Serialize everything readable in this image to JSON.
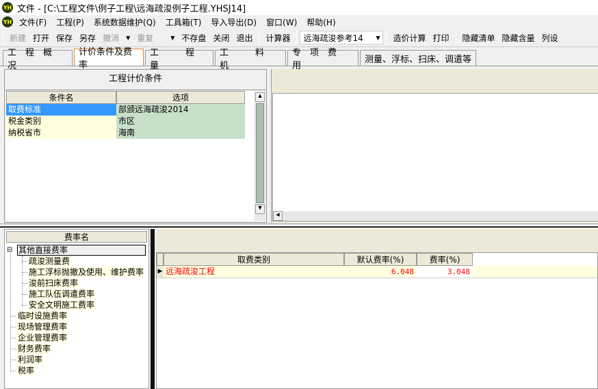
{
  "window": {
    "title": "文件 - [C:\\工程文件\\例子工程\\远海疏浚例子工程.YHSJ14]"
  },
  "menu": [
    "文件(F)",
    "工程(P)",
    "系统数据维护(Q)",
    "工具箱(T)",
    "导入导出(D)",
    "窗口(W)",
    "帮助(H)"
  ],
  "toolbar": {
    "new": "新建",
    "open": "打开",
    "save": "保存",
    "save_as": "另存",
    "undo": "撤消",
    "redo": "重复",
    "no_save": "不存盘",
    "close": "关闭",
    "exit": "退出",
    "calculator": "计算器",
    "reference_combo": "远海疏浚参考14",
    "calc_cost": "造价计算",
    "print": "打印",
    "hide_list": "隐藏清单",
    "hide_content": "隐藏含量",
    "column_settings": "列设"
  },
  "tabs": [
    "工　程　概　况",
    "计价条件及费率",
    "工　　　程　　　量",
    "工　　　料　　　机",
    "专　项　费　用",
    "测量、浮标、扫床、调遣等"
  ],
  "active_tab": 1,
  "conditions": {
    "title": "工程计价条件",
    "headers": [
      "条件名",
      "选项"
    ],
    "rows": [
      [
        "取费标准",
        "部颁远海疏浚2014"
      ],
      [
        "税金类别",
        "市区"
      ],
      [
        "纳税省市",
        "海南"
      ]
    ]
  },
  "rates": {
    "header": "费率名",
    "tree": [
      {
        "label": "其他直接费率",
        "level": 0,
        "expanded": true
      },
      {
        "label": "疏浚测量费",
        "level": 1
      },
      {
        "label": "施工浮标抛撤及使用、维护费率",
        "level": 1
      },
      {
        "label": "浚前扫床费率",
        "level": 1
      },
      {
        "label": "施工队伍调遣费率",
        "level": 1
      },
      {
        "label": "安全文明施工费率",
        "level": 1
      },
      {
        "label": "临时设施费率",
        "level": 0
      },
      {
        "label": "现场管理费率",
        "level": 0
      },
      {
        "label": "企业管理费率",
        "level": 0
      },
      {
        "label": "财务费率",
        "level": 0
      },
      {
        "label": "利润率",
        "level": 0
      },
      {
        "label": "税率",
        "level": 0
      }
    ]
  },
  "fee_table": {
    "headers": [
      "取费类别",
      "默认费率(%)",
      "费率(%)"
    ],
    "rows": [
      [
        "远海疏浚工程",
        "6.048",
        "3.048"
      ]
    ]
  },
  "colors": {
    "highlight": "#3399ff",
    "option_bg": "#c8dfc8",
    "tree_bg": "#ffffe0",
    "red_text": "#ff0000"
  }
}
